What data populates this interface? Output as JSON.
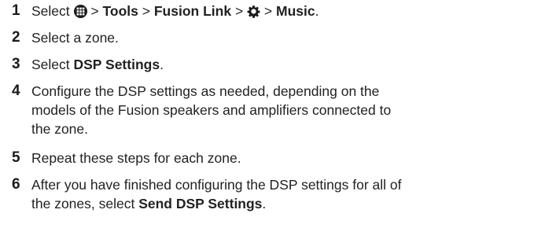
{
  "steps": [
    {
      "number": "1",
      "select": "Select",
      "sep": ">",
      "tools": "Tools",
      "fusion_link": "Fusion Link",
      "music": "Music",
      "end": ".",
      "icons": [
        "home-menu-icon",
        "gear-icon"
      ]
    },
    {
      "number": "2",
      "text": "Select a zone."
    },
    {
      "number": "3",
      "prefix": "Select ",
      "bold": "DSP Settings",
      "suffix": "."
    },
    {
      "number": "4",
      "lines": [
        "Configure the DSP settings as needed, depending on the",
        "models of the Fusion speakers and amplifiers connected to",
        "the zone."
      ]
    },
    {
      "number": "5",
      "text": "Repeat these steps for each zone."
    },
    {
      "number": "6",
      "line1": "After you have finished configuring the DSP settings for all of",
      "line2_prefix": "the zones, select ",
      "bold": "Send DSP Settings",
      "suffix": "."
    }
  ]
}
